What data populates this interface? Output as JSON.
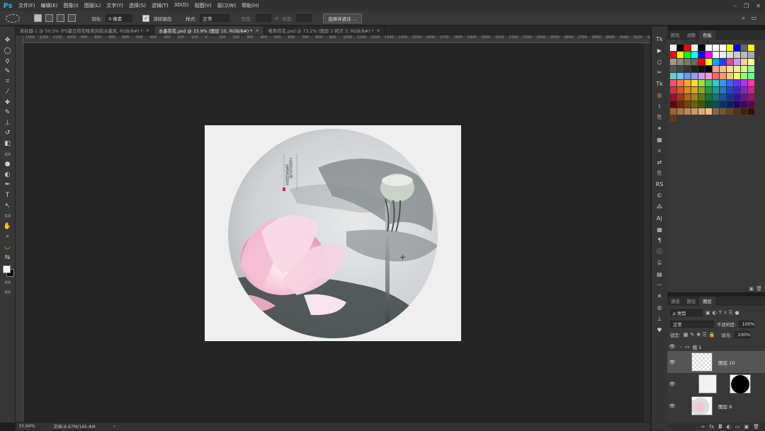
{
  "app": {
    "logo": "Ps"
  },
  "menu": [
    "文件(F)",
    "编辑(E)",
    "图像(I)",
    "图层(L)",
    "文字(Y)",
    "选择(S)",
    "滤镜(T)",
    "3D(D)",
    "视图(V)",
    "窗口(W)",
    "帮助(H)"
  ],
  "window_controls": {
    "minimize": "–",
    "restore": "❐",
    "close": "✕"
  },
  "options": {
    "feather_label": "羽化:",
    "feather_value": "0 像素",
    "antialias_label": "消除锯齿",
    "antialias_checked": "✓",
    "style_label": "样式:",
    "style_value": "正常",
    "width_label": "宽度:",
    "height_label": "高度:",
    "refine_button": "选择并遮住 ..."
  },
  "tabs": [
    {
      "label": "未标题-1 @ 50.5% (PS夏日荷花唯美风和水墨风, RGB/8#) *",
      "close": "×"
    },
    {
      "label": "水墨荷花.psd @ 33.9% (图层 10, RGB/8#) *",
      "close": "×"
    },
    {
      "label": "唯美荷花.psd @ 73.2% (图层 2 拷贝 3, RGB/8#) *",
      "close": "×"
    }
  ],
  "ruler_h": [
    "1300",
    "1200",
    "1100",
    "1000",
    "900",
    "800",
    "700",
    "600",
    "500",
    "400",
    "300",
    "200",
    "100",
    "0",
    "100",
    "200",
    "300",
    "400",
    "500",
    "600",
    "700",
    "800",
    "900",
    "1000",
    "1100",
    "1200",
    "1300",
    "1400",
    "1500",
    "1600",
    "1700",
    "1800",
    "1900",
    "2000",
    "2100",
    "2200",
    "2300",
    "2400",
    "2500",
    "2600",
    "2700",
    "2800",
    "2900",
    "3000",
    "3100",
    "320"
  ],
  "status": {
    "zoom": "33.94%",
    "doc": "文档:8.67M/165.4M",
    "arrow": "›"
  },
  "doc_text": {
    "col1": "立秋荷花开满",
    "col2": "篮满满的荷花"
  },
  "swatch_panel": {
    "tabs": [
      "颜色",
      "调整",
      "色板"
    ]
  },
  "swatch_colors": [
    "#ffffff",
    "#000000",
    "#ff0000",
    "#ffffff",
    "#000000",
    "#ffffff",
    "#ffffff",
    "#ffffff",
    "#ffff00",
    "#0000ff",
    "#666666",
    "#ffff00",
    "#ff0000",
    "#ffff00",
    "#00ff00",
    "#00ffff",
    "#0000ff",
    "#ff00ff",
    "#ffffff",
    "#eeeeee",
    "#dddddd",
    "#cccccc",
    "#bbbbbb",
    "#aaaaaa",
    "#999999",
    "#888888",
    "#777777",
    "#666666",
    "#ff0000",
    "#ffff00",
    "#00aaff",
    "#2040ff",
    "#ee4488",
    "#cc99ff",
    "#ffcc99",
    "#ffff99",
    "#555555",
    "#444444",
    "#333333",
    "#222222",
    "#111111",
    "#000000",
    "#ff9988",
    "#ffbb88",
    "#ffdd99",
    "#ffee88",
    "#ccff88",
    "#99ee99",
    "#66cccc",
    "#66ccff",
    "#6699ff",
    "#9999ff",
    "#cc99ff",
    "#ff99cc",
    "#ff6666",
    "#ff9966",
    "#ffcc66",
    "#ffff66",
    "#99ff66",
    "#66ff99",
    "#ee5566",
    "#ff7744",
    "#ffaa33",
    "#ffdd33",
    "#aadd33",
    "#33cc66",
    "#33cccc",
    "#3399ff",
    "#3366ff",
    "#6633ff",
    "#aa33ff",
    "#ff33aa",
    "#cc3344",
    "#dd5522",
    "#dd8822",
    "#ccaa22",
    "#88aa22",
    "#229944",
    "#229999",
    "#2277cc",
    "#2244cc",
    "#4422cc",
    "#8822cc",
    "#cc2288",
    "#991122",
    "#aa3311",
    "#aa6611",
    "#998811",
    "#667711",
    "#117733",
    "#117777",
    "#115599",
    "#113399",
    "#331199",
    "#661199",
    "#991166",
    "#660011",
    "#772200",
    "#774400",
    "#666600",
    "#445500",
    "#005522",
    "#005555",
    "#003366",
    "#002266",
    "#220066",
    "#440066",
    "#660044",
    "#996633",
    "#aa7744",
    "#bb8855",
    "#cc9966",
    "#ddaa77",
    "#eebb88",
    "#886644",
    "#775533",
    "#664422",
    "#553311",
    "#442200",
    "#331100",
    "#773311"
  ],
  "layers": {
    "tabs": [
      "通道",
      "路径",
      "图层"
    ],
    "filter": "ρ 类型",
    "blend_mode": "正常",
    "opacity_label": "不透明度:",
    "opacity_value": "100%",
    "lock_label": "锁定:",
    "fill_label": "填充:",
    "fill_value": "100%",
    "group_name": "组 1",
    "layer10": "图层 10",
    "layer9": "图层 9",
    "eye": "👁"
  }
}
